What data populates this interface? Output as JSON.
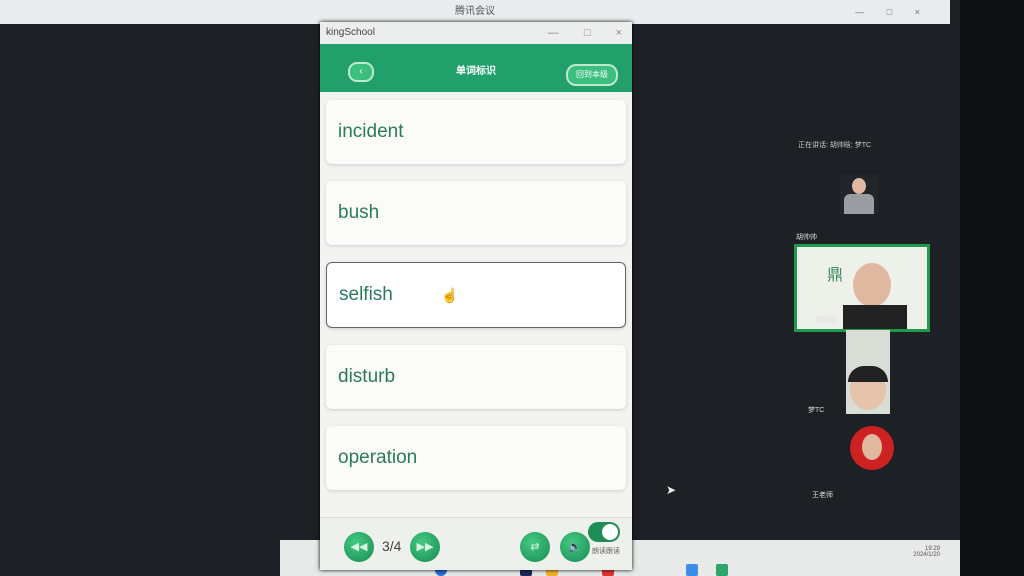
{
  "meeting": {
    "title": "腾讯会议",
    "controls": [
      "—",
      "□",
      "×"
    ]
  },
  "app": {
    "title": "kingSchool",
    "controls": [
      "—",
      "□",
      "×"
    ],
    "header": {
      "title": "单词标识",
      "back_icon": "chevron-left-icon",
      "right_button": "回到本级"
    },
    "words": [
      "incident",
      "bush",
      "selfish",
      "disturb",
      "operation"
    ],
    "selected_index": 2,
    "footer": {
      "page": "3/4",
      "toggle_label": "朗读跟读",
      "toggle_on": true
    }
  },
  "participants": {
    "speaking": "正在讲话: 胡帅晗; 梦TC",
    "people": [
      {
        "name": "胡帅帅"
      },
      {
        "name": "胡帅晗"
      },
      {
        "name": "梦TC"
      },
      {
        "name": "王老师"
      }
    ]
  },
  "taskbar": {
    "time": "19:29",
    "date": "2024/1/20"
  },
  "colors": {
    "accent": "#21a06c",
    "active_border": "#1e9a4a"
  }
}
